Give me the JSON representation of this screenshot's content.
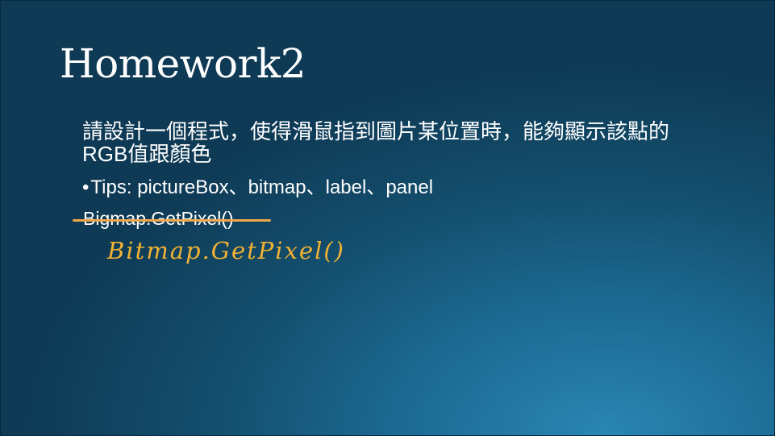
{
  "slide": {
    "title": "Homework2",
    "body_line1": "請設計一個程式，使得滑鼠指到圖片某位置時，能夠顯示該點的",
    "body_line2": "RGB值跟顏色",
    "tips_bullet": "•",
    "tips_text": "Tips: pictureBox、bitmap、label、panel",
    "struck_text": "Bigmap.GetPixel()",
    "handwritten_correction": "Bitmap.GetPixel()"
  },
  "colors": {
    "background_dark": "#0e3a55",
    "background_light": "#2a86b3",
    "text": "#ffffff",
    "annotation": "#f3b233",
    "strike": "#f0a64a"
  }
}
